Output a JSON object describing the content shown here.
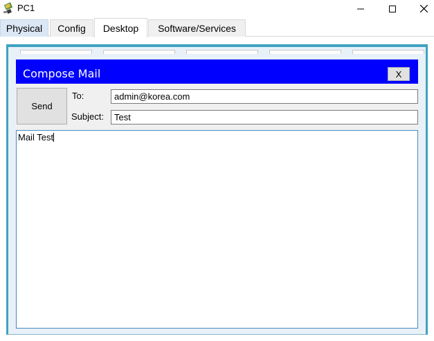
{
  "window": {
    "title": "PC1",
    "icon": "pc-icon",
    "controls": {
      "minimize": "minimize-icon",
      "maximize": "maximize-icon",
      "close": "close-icon"
    }
  },
  "tabs": [
    {
      "label": "Physical"
    },
    {
      "label": "Config"
    },
    {
      "label": "Desktop",
      "selected": true
    },
    {
      "label": "Software/Services"
    }
  ],
  "compose": {
    "title": "Compose Mail",
    "close_label": "X",
    "send_label": "Send",
    "to_label": "To:",
    "to_value": "admin@korea.com",
    "subject_label": "Subject:",
    "subject_value": "Test",
    "body_value": "Mail Test"
  },
  "colors": {
    "header_blue": "#0000ff",
    "desktop_border": "#3fa2c0",
    "body_border": "#4a88c0"
  }
}
